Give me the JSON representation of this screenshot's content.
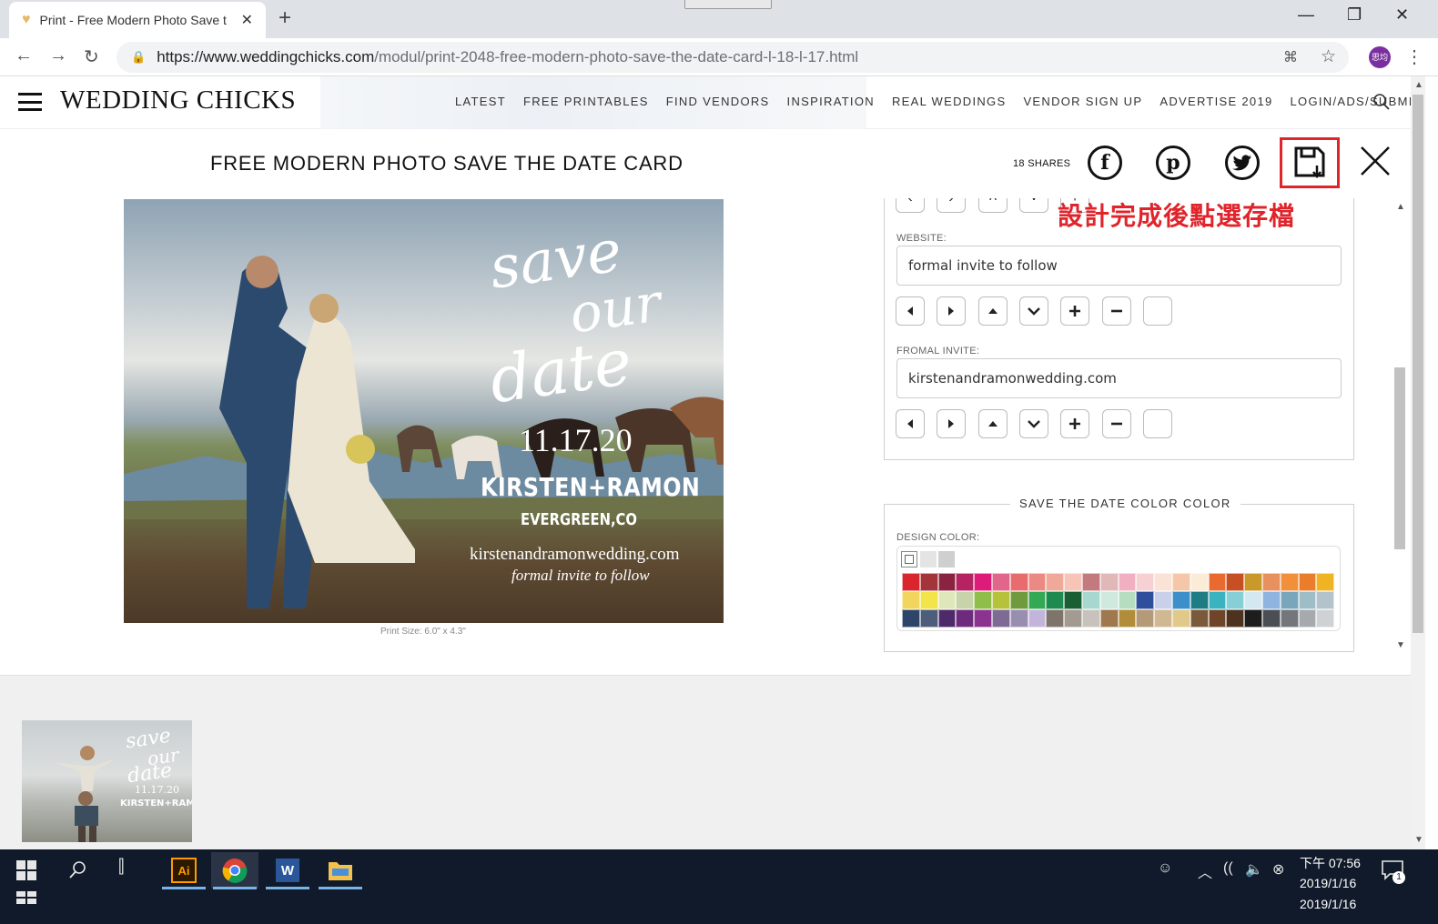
{
  "browser": {
    "tab_title": "Print - Free Modern Photo Save the Date Card",
    "tab_close": "✕",
    "new_tab": "+",
    "url_host": "https://www.weddingchicks.com",
    "url_path": "/modul/print-2048-free-modern-photo-save-the-date-card-l-18-l-17.html",
    "profile_label": "思均"
  },
  "site": {
    "logo": "WEDDING CHICKS",
    "nav": [
      "LATEST",
      "FREE PRINTABLES",
      "FIND VENDORS",
      "INSPIRATION",
      "REAL WEDDINGS",
      "VENDOR SIGN UP",
      "ADVERTISE 2019",
      "LOGIN/ADS/SUBMIT"
    ]
  },
  "print": {
    "title": "FREE MODERN PHOTO SAVE THE DATE CARD",
    "shares": "18 SHARES",
    "print_size": "Print Size: 6.0\" x 4.3\""
  },
  "card": {
    "line1": "save",
    "line2": "our",
    "line3": "date",
    "date": "11.17.20",
    "names": "KIRSTEN+RAMON",
    "place": "EVERGREEN,CO",
    "website": "kirstenandramonwedding.com",
    "invite": "formal invite to follow"
  },
  "editor": {
    "annotation": "設計完成後點選存檔",
    "fields": [
      {
        "label": "WEBSITE:",
        "value": "formal invite to follow"
      },
      {
        "label": "FROMAL INVITE:",
        "value": "kirstenandramonwedding.com"
      }
    ],
    "color_section_title": "SAVE THE DATE COLOR COLOR",
    "design_color_label": "DESIGN COLOR:",
    "top_swatches": [
      "#ffffff",
      "#e4e4e4",
      "#cfcfcf"
    ],
    "swatches": [
      "#d8262c",
      "#a2343a",
      "#8a2340",
      "#b62362",
      "#dd1c7a",
      "#e0678a",
      "#e86b6e",
      "#eb8a82",
      "#f0a999",
      "#f6c5b8",
      "#c27a7e",
      "#e0b8b8",
      "#f1b0c2",
      "#f7d0d4",
      "#fbe2d6",
      "#f5c7a8",
      "#fbecd8",
      "#e86a2e",
      "#c65024",
      "#c99a2a",
      "#e99060",
      "#f28f3b",
      "#ea7d2b",
      "#f0b324",
      "#f2d55c",
      "#f3e44a",
      "#dfe7ba",
      "#c9d3a9",
      "#8fbf4a",
      "#b5c23a",
      "#6f9a3d",
      "#34a853",
      "#1e8a4f",
      "#1a5e34",
      "#a7d8cf",
      "#cfe9df",
      "#b7ddc0",
      "#2f4f9e",
      "#c9d1ea",
      "#3c8fc9",
      "#1f7c85",
      "#3bb2c0",
      "#86cfd6",
      "#d3e8ef",
      "#8fb4e0",
      "#79a6ba",
      "#9fbdc6",
      "#b3c3cc",
      "#2e4569",
      "#4d5d7a",
      "#4e2a6a",
      "#6e2b7d",
      "#8a3490",
      "#7d6b95",
      "#9a8eb0",
      "#c3b5d9",
      "#7e746b",
      "#a39b92",
      "#c7c2bb",
      "#a0784e",
      "#b08c3b",
      "#b49a77",
      "#d0b893",
      "#e1c98c",
      "#7b5a3c",
      "#6e4528",
      "#4e3220",
      "#1d1d1d",
      "#4b4e52",
      "#73777c",
      "#a6aaae",
      "#cfd2d4"
    ]
  },
  "thumb": {
    "line1": "save",
    "line2": "our",
    "line3": "date",
    "date": "11.17.20",
    "names": "KIRSTEN+RAMON"
  },
  "taskbar": {
    "ai_label": "Ai",
    "time": "下午 07:56",
    "date": "2019/1/16",
    "date_repeat": "2019/1/16",
    "notif_count": "1"
  }
}
